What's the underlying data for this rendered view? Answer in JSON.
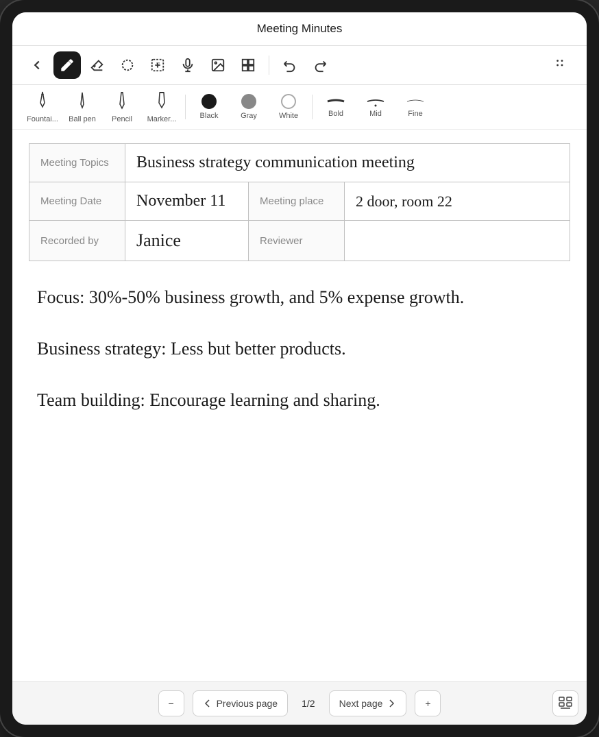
{
  "app": {
    "title": "Meeting Minutes"
  },
  "toolbar": {
    "back_label": "←",
    "tools": [
      {
        "id": "pen",
        "label": "✒",
        "active": true
      },
      {
        "id": "eraser",
        "label": "◇"
      },
      {
        "id": "lasso",
        "label": "⊙"
      },
      {
        "id": "text",
        "label": "T"
      },
      {
        "id": "mic",
        "label": "🎤"
      },
      {
        "id": "image",
        "label": "🖼"
      },
      {
        "id": "layout",
        "label": "⊞"
      }
    ],
    "undo_label": "↩",
    "redo_label": "↩",
    "more_label": "⋮⋮"
  },
  "pen_toolbar": {
    "pens": [
      {
        "id": "fountain",
        "label": "Fountai...",
        "icon": "✒"
      },
      {
        "id": "ballpen",
        "label": "Ball pen",
        "icon": "✒"
      },
      {
        "id": "pencil",
        "label": "Pencil",
        "icon": "✏"
      },
      {
        "id": "marker",
        "label": "Marker...",
        "icon": "✒"
      }
    ],
    "colors": [
      {
        "id": "black",
        "label": "Black",
        "value": "#1a1a1a",
        "active": true
      },
      {
        "id": "gray",
        "label": "Gray",
        "value": "#888888"
      },
      {
        "id": "white",
        "label": "White",
        "value": "#ffffff"
      }
    ],
    "strokes": [
      {
        "id": "bold",
        "label": "Bold"
      },
      {
        "id": "mid",
        "label": "Mid"
      },
      {
        "id": "fine",
        "label": "Fine"
      }
    ]
  },
  "table": {
    "rows": [
      {
        "label": "Meeting Topics",
        "value": "Business strategy communication meeting",
        "colspan": true
      },
      {
        "label": "Meeting Date",
        "value": "November 11",
        "label2": "Meeting place",
        "value2": "2 door, room 22"
      },
      {
        "label": "Recorded by",
        "value": "Janice",
        "label2": "Reviewer",
        "value2": ""
      }
    ]
  },
  "notes": {
    "lines": [
      "Focus: 30%-50% business growth, and 5% expense growth.",
      "Business strategy: Less but better products.",
      "Team building: Encourage learning and sharing."
    ]
  },
  "pagination": {
    "previous_label": "Previous page",
    "next_label": "Next page",
    "current": "1",
    "total": "2",
    "separator": "/"
  }
}
